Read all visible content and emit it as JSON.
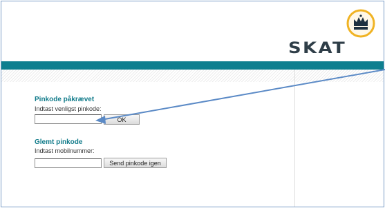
{
  "brand": {
    "name": "SKAT"
  },
  "pin_section": {
    "title": "Pinkode påkrævet",
    "instruction": "Indtast venligst pinkode:",
    "input_value": "",
    "submit_label": "OK"
  },
  "forgot_section": {
    "title": "Glemt pinkode",
    "instruction": "Indtast mobilnummer:",
    "input_value": "",
    "submit_label": "Send pinkode igen"
  },
  "colors": {
    "accent_teal": "#0e7f8f",
    "heading_teal": "#117b8a",
    "logo_gold": "#f0b323",
    "annotation_arrow": "#5b8ac6"
  },
  "icons": {
    "logo": "crown-icon",
    "annotation": "arrow-pointer"
  }
}
